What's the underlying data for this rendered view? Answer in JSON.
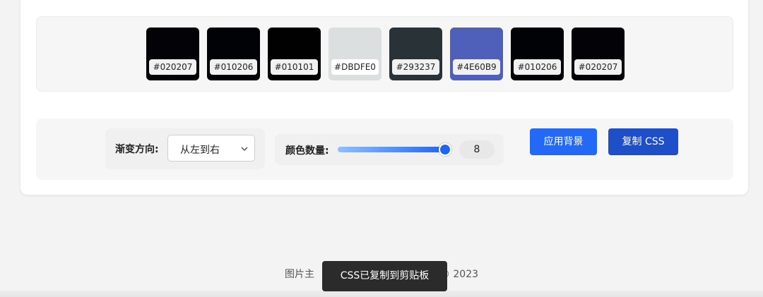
{
  "swatches": [
    {
      "hex": "#020207",
      "color": "#020207"
    },
    {
      "hex": "#010206",
      "color": "#010206"
    },
    {
      "hex": "#010101",
      "color": "#010101"
    },
    {
      "hex": "#DBDFE0",
      "color": "#DBDFE0"
    },
    {
      "hex": "#293237",
      "color": "#293237"
    },
    {
      "hex": "#4E60B9",
      "color": "#4E60B9"
    },
    {
      "hex": "#010206",
      "color": "#010206"
    },
    {
      "hex": "#020207",
      "color": "#020207"
    }
  ],
  "controls": {
    "direction_label": "渐变方向:",
    "direction_selected": "从左到右",
    "count_label": "颜色数量:",
    "count_value": "8",
    "slider_fraction": 1.0,
    "apply_button": "应用背景",
    "copy_button": "复制 CSS"
  },
  "footer": {
    "text_left": "图片主",
    "text_right": "© 2023"
  },
  "toast": {
    "text": "CSS已复制到剪贴板"
  },
  "colors": {
    "primary": "#2469f5",
    "primary_dark": "#1e4fc9",
    "toast_bg": "#2b2b2b"
  }
}
